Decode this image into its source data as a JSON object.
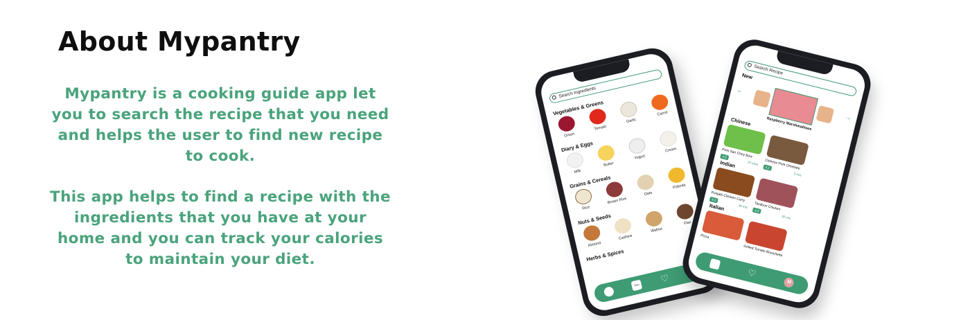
{
  "heading": "About Mypantry",
  "description_1": "Mypantry is a cooking guide app let you to search the recipe that you need and helps the user to find new recipe to cook.",
  "description_2": "This app helps to find a recipe with the ingredients that you have at your home and you can track your calories to maintain your diet.",
  "colors": {
    "accent": "#4aa37c",
    "app_green": "#3e9b73",
    "title": "#0f0f0f"
  },
  "pantry_screen": {
    "search_placeholder": "Search Ingredients",
    "sections": [
      {
        "title": "Vegetables & Greens",
        "items": [
          "Onion",
          "Tomato",
          "Garlic",
          "Carrot"
        ]
      },
      {
        "title": "Diary & Eggs",
        "items": [
          "Milk",
          "Butter",
          "Yogurt",
          "Cream"
        ]
      },
      {
        "title": "Grains & Cereals",
        "items": [
          "Rice",
          "Brown Rice",
          "Oats",
          "Polenta"
        ]
      },
      {
        "title": "Nuts & Seeds",
        "items": [
          "Almond",
          "Cashew",
          "Walnut",
          "Flax"
        ]
      },
      {
        "title": "Herbs & Spices",
        "items": []
      }
    ],
    "nav_icons": [
      "home-icon",
      "pantry-icon",
      "heart-icon",
      "profile-icon"
    ],
    "nav_pantry_label": "Pan",
    "nav_profile_letter": "M"
  },
  "recipe_screen": {
    "search_placeholder": "Search Recipe",
    "new_label": "New",
    "featured_recipe": "Raspberry Marshmallows",
    "categories": [
      {
        "title": "Chinese",
        "recipes": [
          {
            "name": "Pork San Choy Bow",
            "rating": "4.5",
            "time": "20 mins"
          },
          {
            "name": "Chinese Pork Omelette",
            "rating": "4.1",
            "time": "5 mis"
          }
        ]
      },
      {
        "title": "Indian",
        "recipes": [
          {
            "name": "Punjabi Chicken Curry",
            "rating": "4.2",
            "time": "40 mis"
          },
          {
            "name": "Tandoori Chicken",
            "rating": "4.3",
            "time": "35 mis"
          }
        ]
      },
      {
        "title": "Italian",
        "recipes": [
          {
            "name": "Pizza",
            "rating": "",
            "time": ""
          },
          {
            "name": "Grilled Tomato Bruschetta",
            "rating": "",
            "time": ""
          }
        ]
      }
    ],
    "nav_profile_letter": "M"
  }
}
